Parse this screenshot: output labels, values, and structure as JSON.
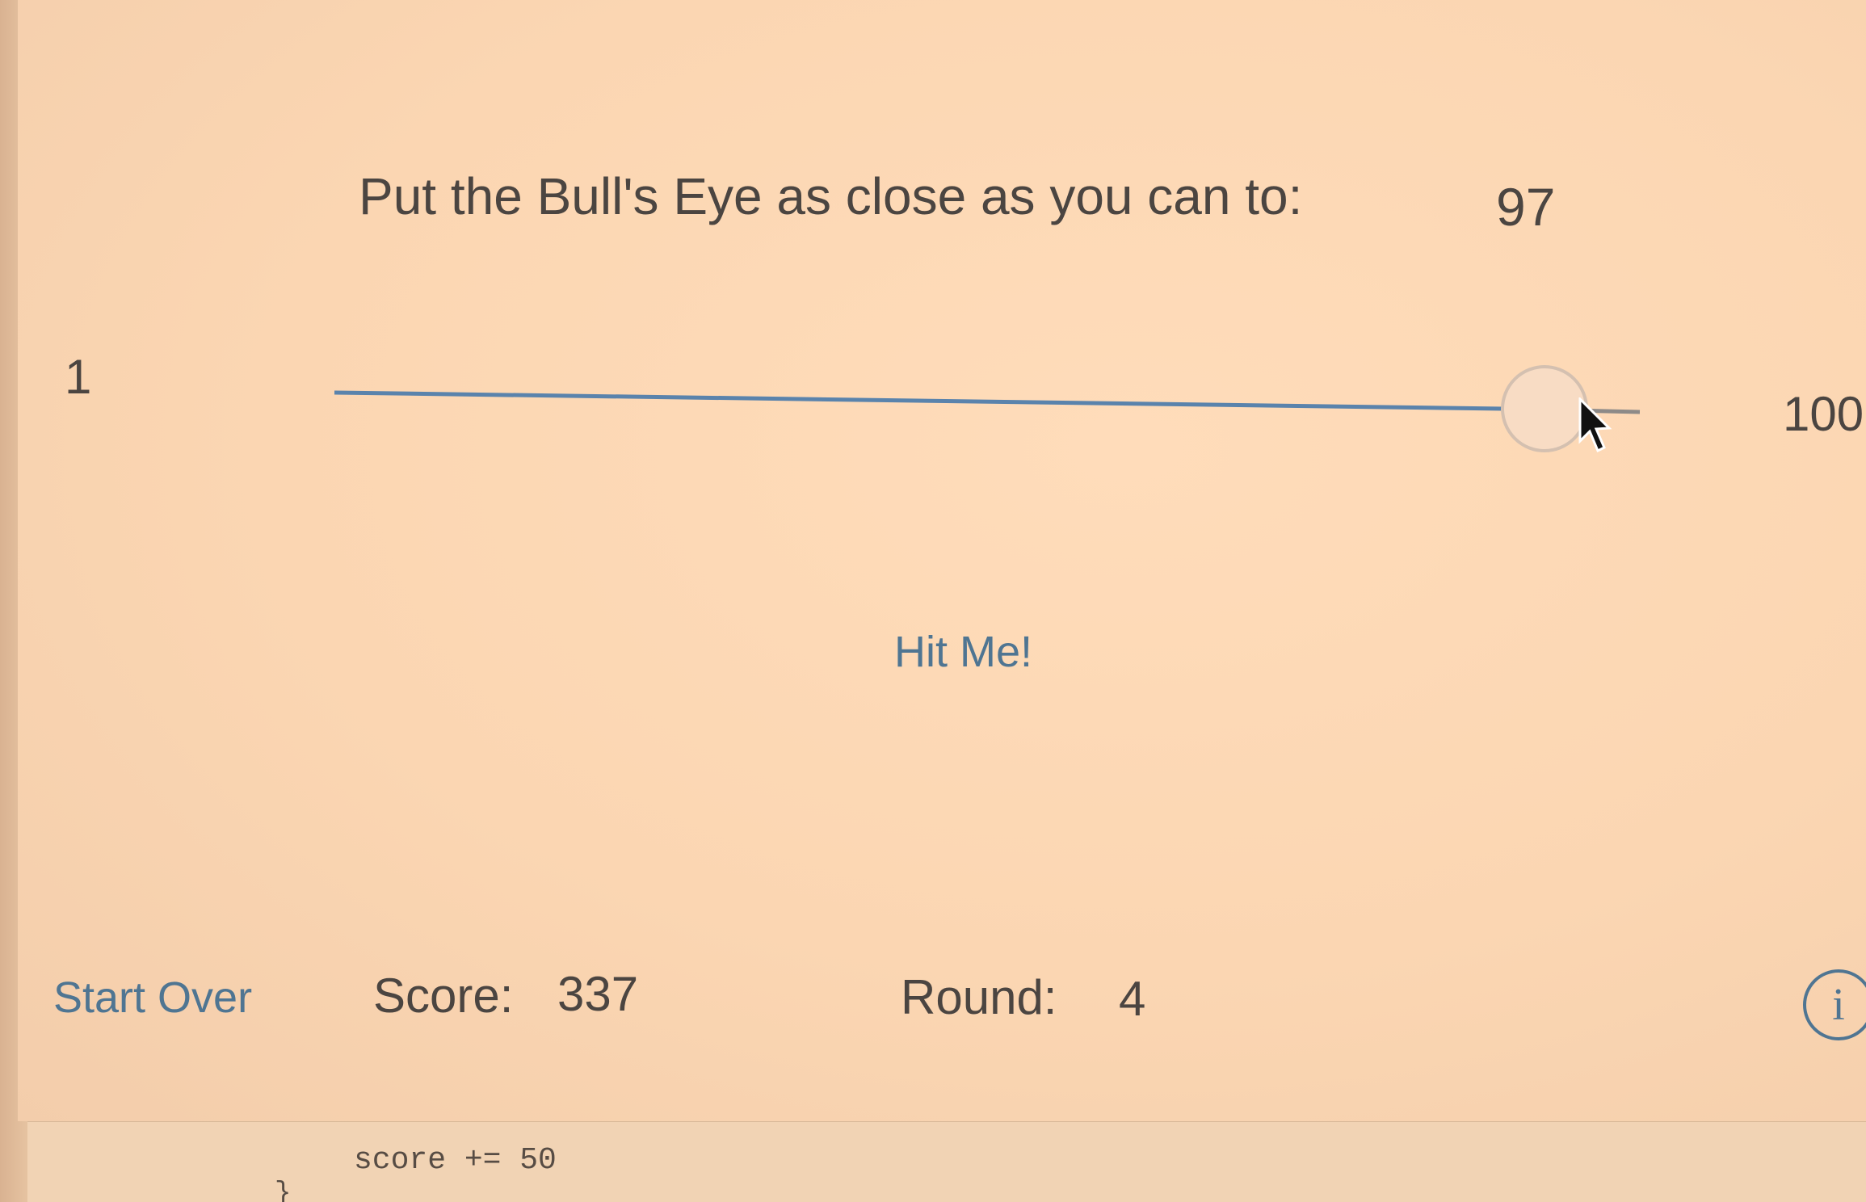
{
  "prompt": {
    "text": "Put the Bull's Eye as close as you can to:",
    "target_value": "97"
  },
  "slider": {
    "min_label": "1",
    "max_label": "100",
    "min": 1,
    "max": 100,
    "value": 97
  },
  "hit_button": {
    "label": "Hit Me!"
  },
  "bottom_bar": {
    "start_over_label": "Start Over",
    "score_label": "Score:",
    "score_value": "337",
    "round_label": "Round:",
    "round_value": "4",
    "info_glyph": "i"
  },
  "code_editor": {
    "visible_line": "score += 50",
    "closing_brace": "}"
  },
  "colors": {
    "background": "#fbd7b4",
    "accent": "#4f7592",
    "text": "#4b4541"
  }
}
